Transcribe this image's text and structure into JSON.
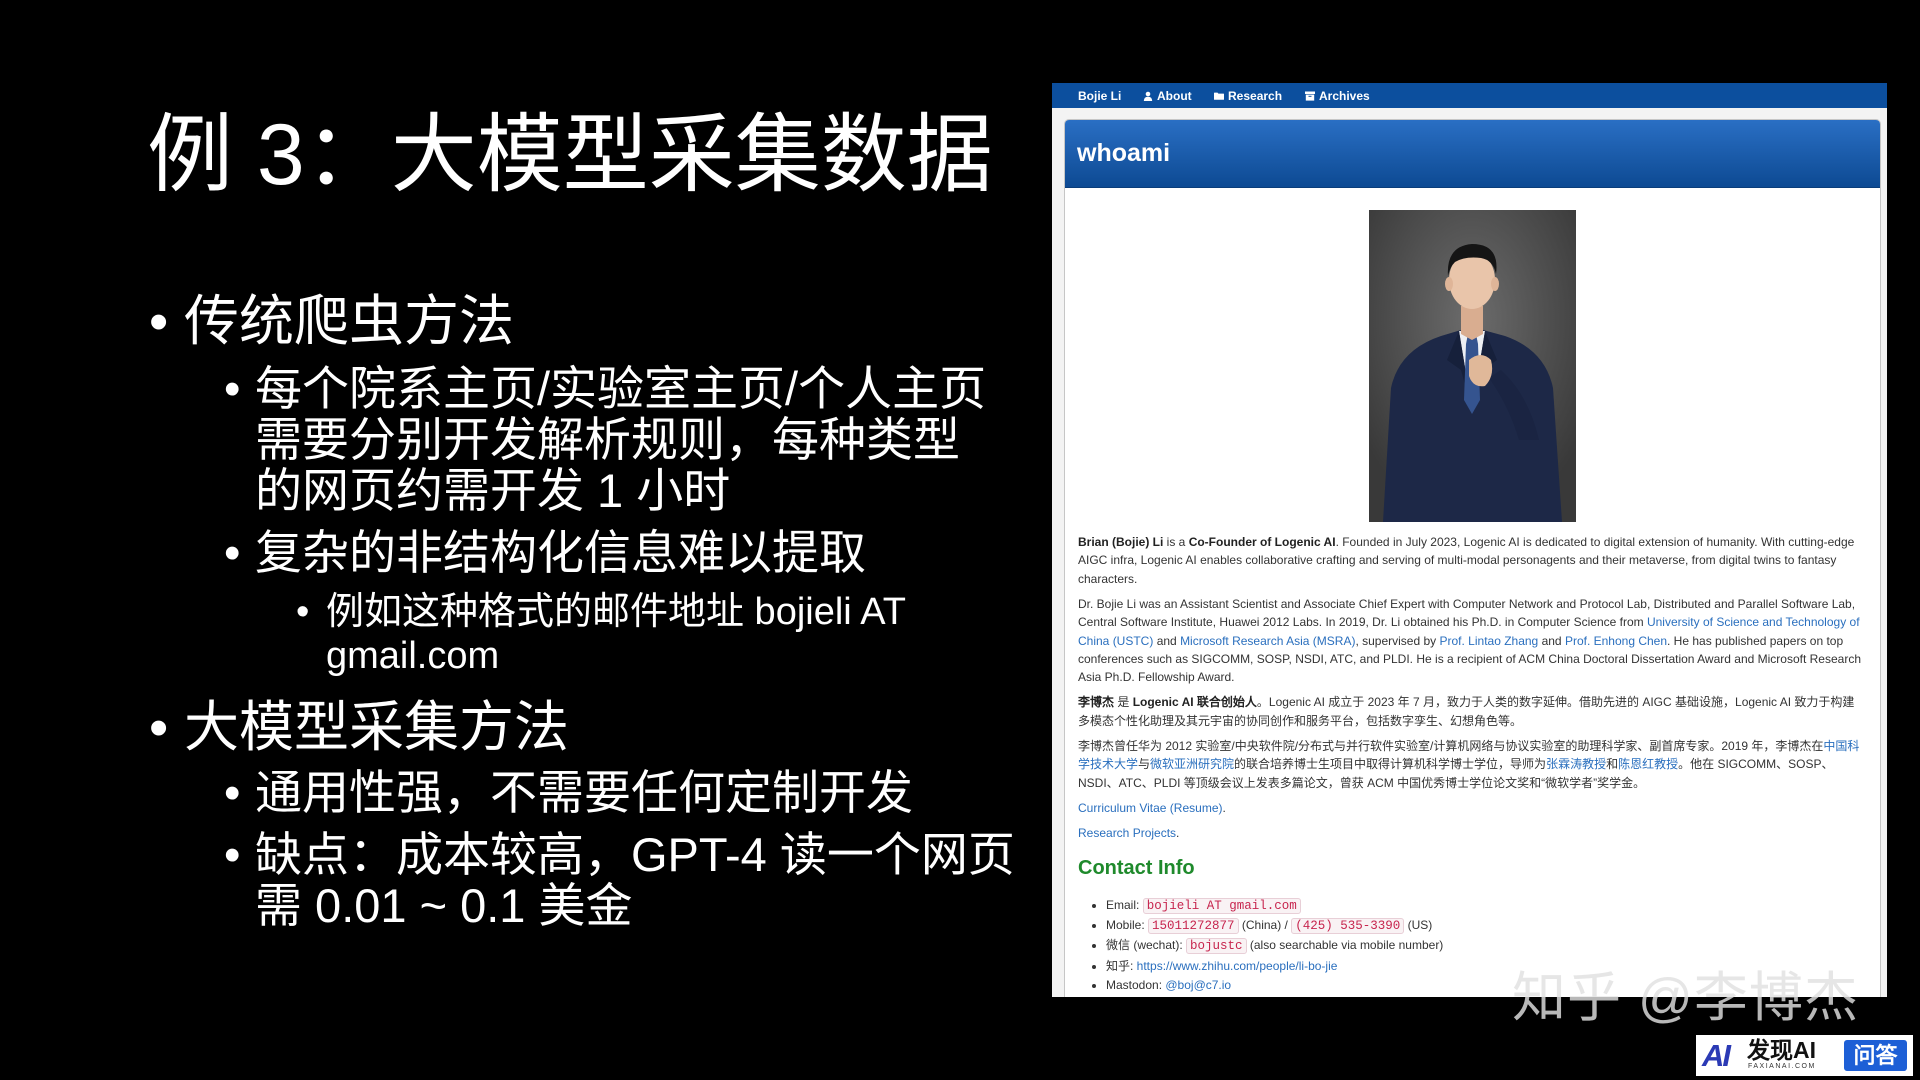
{
  "colors": {
    "slide_bg": "#000000",
    "slide_text": "#ffffff",
    "nav_bg": "#0c4f9e",
    "header_top": "#2a6fc4",
    "header_bottom": "#0d4a93",
    "link": "#2a6fbe",
    "contact_heading": "#1f8a2c",
    "code_text": "#c7254e",
    "code_bg": "#f9f2f4",
    "logo_blue": "#1d5fd6"
  },
  "slide": {
    "title": "例 3：大模型采集数据",
    "sections": [
      {
        "heading": "传统爬虫方法",
        "items": [
          {
            "lines": [
              "每个院系主页/实验室主页/个人主页",
              "需要分别开发解析规则，每种类型",
              "的网页约需开发 1 小时"
            ]
          },
          {
            "lines": [
              "复杂的非结构化信息难以提取"
            ],
            "subitems": [
              {
                "lines": [
                  "例如这种格式的邮件地址 bojieli AT",
                  "gmail.com"
                ]
              }
            ]
          }
        ]
      },
      {
        "heading": "大模型采集方法",
        "items": [
          {
            "lines": [
              "通用性强，不需要任何定制开发"
            ]
          },
          {
            "lines": [
              "缺点：成本较高，GPT-4 读一个网页",
              "需 0.01 ~ 0.1 美金"
            ]
          }
        ]
      }
    ]
  },
  "webpage": {
    "nav": {
      "brand": "Bojie Li",
      "items": [
        {
          "label": "About",
          "icon": "user-icon"
        },
        {
          "label": "Research",
          "icon": "folder-icon"
        },
        {
          "label": "Archives",
          "icon": "archive-icon"
        }
      ]
    },
    "panel_title": "whoami",
    "about": [
      [
        {
          "t": "Brian (Bojie) Li",
          "s": "b"
        },
        {
          "t": " is a "
        },
        {
          "t": "Co-Founder of Logenic AI",
          "s": "b"
        },
        {
          "t": ". Founded in July 2023, Logenic AI is dedicated to digital extension of humanity. With cutting-edge AIGC infra, Logenic AI enables collaborative crafting and serving of multi-modal personagents and their metaverse, from digital twins to fantasy characters."
        }
      ],
      [
        {
          "t": "Dr. Bojie Li was an Assistant Scientist and Associate Chief Expert with Computer Network and Protocol Lab, Distributed and Parallel Software Lab, Central Software Institute, Huawei 2012 Labs. In 2019, Dr. Li obtained his Ph.D. in Computer Science from "
        },
        {
          "t": "University of Science and Technology of China (USTC)",
          "s": "a"
        },
        {
          "t": " and "
        },
        {
          "t": "Microsoft Research Asia (MSRA)",
          "s": "a"
        },
        {
          "t": ", supervised by "
        },
        {
          "t": "Prof. Lintao Zhang",
          "s": "a"
        },
        {
          "t": " and "
        },
        {
          "t": "Prof. Enhong Chen",
          "s": "a"
        },
        {
          "t": ". He has published papers on top conferences such as SIGCOMM, SOSP, NSDI, ATC, and PLDI. He is a recipient of ACM China Doctoral Dissertation Award and Microsoft Research Asia Ph.D. Fellowship Award."
        }
      ],
      [
        {
          "t": "李博杰",
          "s": "b"
        },
        {
          "t": " 是 "
        },
        {
          "t": "Logenic AI 联合创始人",
          "s": "b"
        },
        {
          "t": "。Logenic AI 成立于 2023 年 7 月，致力于人类的数字延伸。借助先进的 AIGC 基础设施，Logenic AI 致力于构建多模态个性化助理及其元宇宙的协同创作和服务平台，包括数字孪生、幻想角色等。"
        }
      ],
      [
        {
          "t": "李博杰曾任华为 2012 实验室/中央软件院/分布式与并行软件实验室/计算机网络与协议实验室的助理科学家、副首席专家。2019 年，李博杰在"
        },
        {
          "t": "中国科学技术大学",
          "s": "a"
        },
        {
          "t": "与"
        },
        {
          "t": "微软亚洲研究院",
          "s": "a"
        },
        {
          "t": "的联合培养博士生项目中取得计算机科学博士学位，导师为"
        },
        {
          "t": "张霖涛教授",
          "s": "a"
        },
        {
          "t": "和"
        },
        {
          "t": "陈恩红教授",
          "s": "a"
        },
        {
          "t": "。他在 SIGCOMM、SOSP、NSDI、ATC、PLDI 等顶级会议上发表多篇论文，曾获 ACM 中国优秀博士学位论文奖和“微软学者”奖学金。"
        }
      ],
      [
        {
          "t": "Curriculum Vitae (Resume)",
          "s": "a"
        },
        {
          "t": "."
        }
      ],
      [
        {
          "t": "Research Projects",
          "s": "a"
        },
        {
          "t": "."
        }
      ]
    ],
    "contact": {
      "heading": "Contact Info",
      "items": [
        [
          {
            "t": "Email: "
          },
          {
            "t": "bojieli AT gmail.com",
            "s": "c"
          }
        ],
        [
          {
            "t": "Mobile: "
          },
          {
            "t": "15011272877",
            "s": "c"
          },
          {
            "t": " (China) / "
          },
          {
            "t": "(425) 535-3390",
            "s": "c"
          },
          {
            "t": " (US)"
          }
        ],
        [
          {
            "t": "微信 (wechat): "
          },
          {
            "t": "bojustc",
            "s": "c"
          },
          {
            "t": " (also searchable via mobile number)"
          }
        ],
        [
          {
            "t": "知乎: "
          },
          {
            "t": "https://www.zhihu.com/people/li-bo-jie",
            "s": "a"
          }
        ],
        [
          {
            "t": "Mastodon: "
          },
          {
            "t": "@boj@c7.io",
            "s": "a"
          }
        ]
      ]
    }
  },
  "watermark": "知乎 @李博杰",
  "logo": {
    "mark": "AI",
    "brand": "发现AI",
    "domain": "FAXIANAI.COM",
    "tag": "问答"
  }
}
